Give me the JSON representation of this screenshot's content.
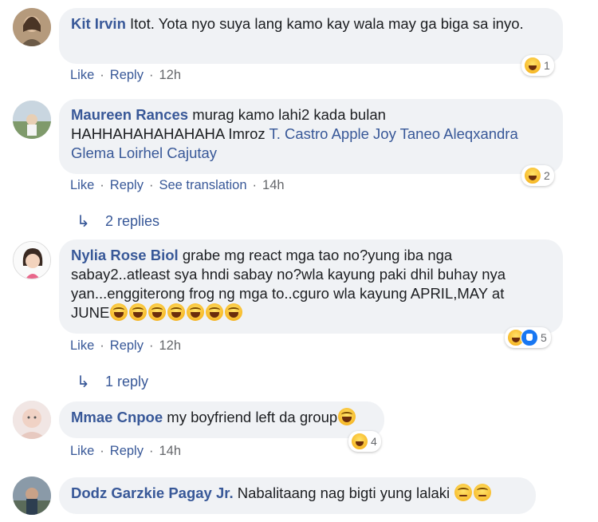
{
  "comments": [
    {
      "name": "Kit Irvin",
      "text": "Itot. Yota nyo suya lang kamo kay wala may ga biga sa inyo.",
      "reaction_count": "1",
      "actions": [
        "Like",
        "Reply",
        "12h"
      ]
    },
    {
      "name": "Maureen Rances",
      "text_1": "murag kamo lahi2 kada bulan",
      "text_2": "HAHHAHAHAHAHAHA Imroz",
      "tags": "T. Castro Apple Joy Taneo Aleqxandra Glema Loirhel Cajutay",
      "reaction_count": "2",
      "actions": [
        "Like",
        "Reply",
        "See translation",
        "14h"
      ],
      "replies_label": "2 replies"
    },
    {
      "name": "Nylia Rose Biol",
      "text_1": "grabe mg react mga tao no?yung iba nga",
      "text_2": "sabay2..atleast sya hndi sabay no?wla kayung paki dhil buhay nya",
      "text_3": "yan...enggiterong frog ng mga to..cguro wla kayung APRIL,MAY at",
      "text_4": "JUNE",
      "reaction_count": "5",
      "actions": [
        "Like",
        "Reply",
        "12h"
      ],
      "replies_label": "1 reply"
    },
    {
      "name": "Mmae Cnpoe",
      "text": "my boyfriend left da group",
      "reaction_count": "4",
      "actions": [
        "Like",
        "Reply",
        "14h"
      ]
    },
    {
      "name": "Dodz Garzkie Pagay Jr.",
      "text": "Nabalitaang nag bigti yung lalaki"
    }
  ],
  "separator": "·",
  "icons": [
    "laughing-emoji-icon",
    "like-reaction-icon",
    "sad-emoji-icon",
    "reply-arrow-icon"
  ],
  "colors": {
    "link": "#385898",
    "bubble": "#f0f2f5",
    "meta": "#65676b"
  }
}
